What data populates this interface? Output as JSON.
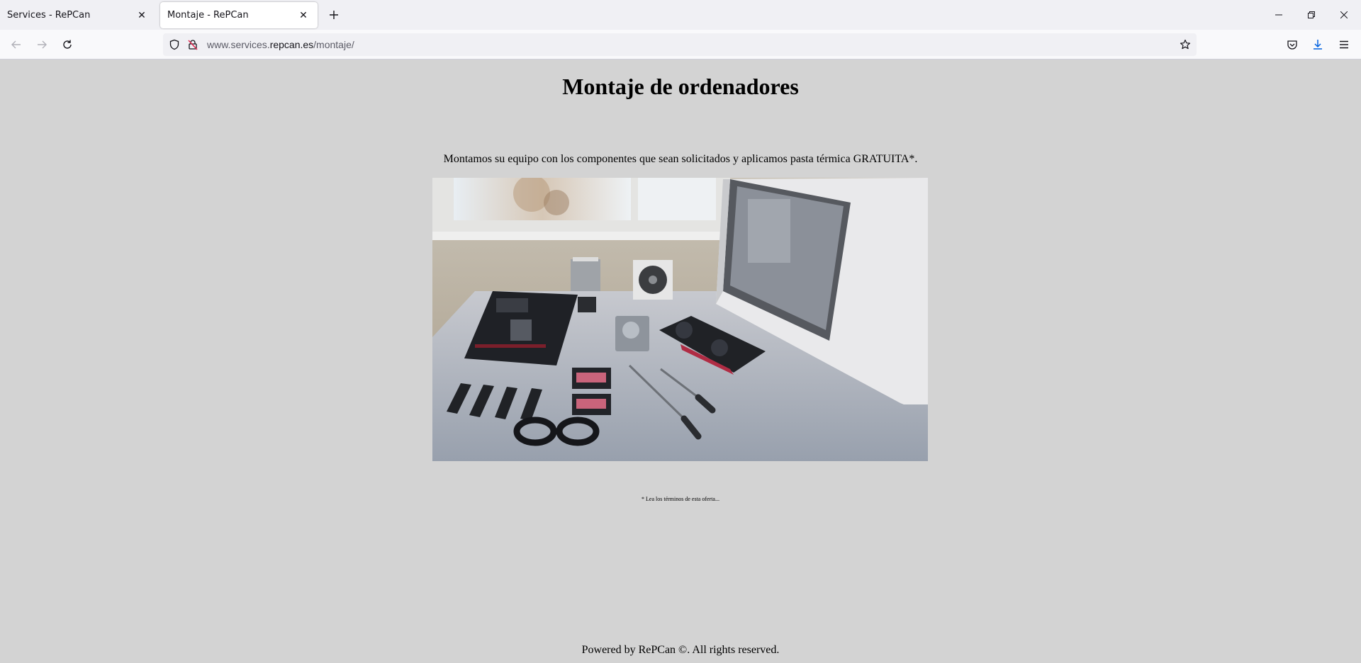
{
  "browser": {
    "tabs": [
      {
        "title": "Services - RePCan",
        "active": false
      },
      {
        "title": "Montaje - RePCan",
        "active": true
      }
    ],
    "url": {
      "prefix": "www.services.",
      "domain": "repcan.es",
      "path": "/montaje/"
    },
    "icons": {
      "back": "arrow-left-icon",
      "forward": "arrow-right-icon",
      "reload": "reload-icon",
      "tracking": "shield-icon",
      "insecure": "lock-strikethrough-icon",
      "bookmark": "star-icon",
      "pocket": "pocket-icon",
      "downloads": "download-icon",
      "menu": "hamburger-icon"
    },
    "accent": "#0061e0"
  },
  "page": {
    "title": "Montaje de ordenadores",
    "description": "Montamos su equipo con los componentes que sean solicitados y aplicamos pasta térmica GRATUITA*.",
    "footnote": "* Lea los términos de esta oferta...",
    "footer": "Powered by RePCan ©. All rights reserved.",
    "background": "#d3d3d3"
  }
}
